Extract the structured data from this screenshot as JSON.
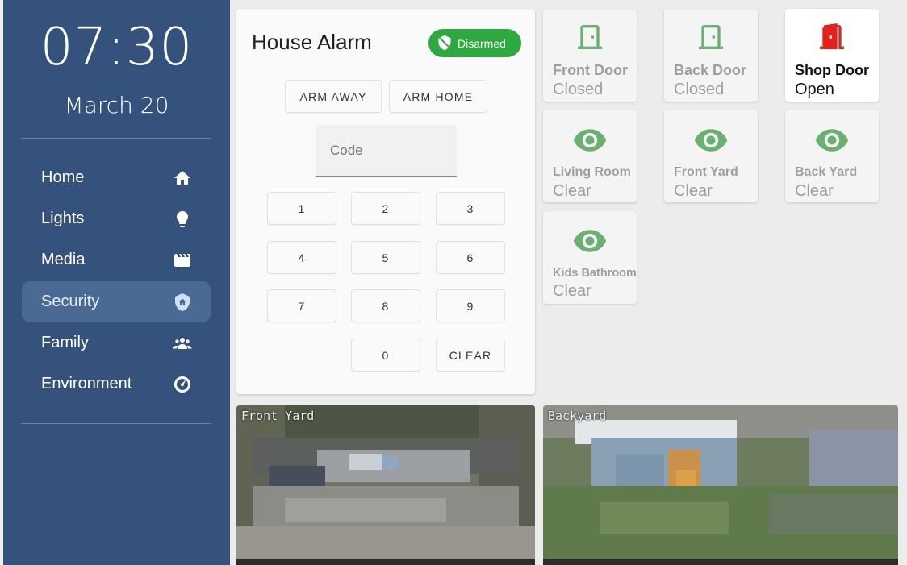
{
  "sidebar": {
    "time": "07:30",
    "date": "March 20",
    "items": [
      {
        "label": "Home",
        "icon": "home-icon"
      },
      {
        "label": "Lights",
        "icon": "lightbulb-icon"
      },
      {
        "label": "Media",
        "icon": "movie-clapper-icon"
      },
      {
        "label": "Security",
        "icon": "shield-home-icon",
        "active": true
      },
      {
        "label": "Family",
        "icon": "people-group-icon"
      },
      {
        "label": "Environment",
        "icon": "gauge-icon"
      }
    ],
    "background_color": "#34527b",
    "active_color": "#4a6a94"
  },
  "alarm": {
    "title": "House Alarm",
    "status": "Disarmed",
    "status_color": "#2ea840",
    "arm_away_label": "ARM AWAY",
    "arm_home_label": "ARM HOME",
    "code_placeholder": "Code",
    "keys": [
      "1",
      "2",
      "3",
      "4",
      "5",
      "6",
      "7",
      "8",
      "9",
      "0"
    ],
    "clear_label": "CLEAR"
  },
  "sensors": [
    {
      "name": "Front Door",
      "state": "Closed",
      "icon": "door-closed-icon"
    },
    {
      "name": "Back Door",
      "state": "Closed",
      "icon": "door-closed-icon"
    },
    {
      "name": "Shop Door",
      "state": "Open",
      "icon": "door-open-icon",
      "alert": true
    },
    {
      "name": "Living Room",
      "state": "Clear",
      "icon": "eye-icon"
    },
    {
      "name": "Front Yard",
      "state": "Clear",
      "icon": "eye-icon"
    },
    {
      "name": "Back Yard",
      "state": "Clear",
      "icon": "eye-icon"
    },
    {
      "name": "Kids Bathroom",
      "state": "Clear",
      "icon": "eye-icon"
    }
  ],
  "colors": {
    "ok_icon": "#6ab071",
    "alert_icon": "#e5211c"
  },
  "cameras": [
    {
      "label": "Front Yard"
    },
    {
      "label": "Backyard"
    }
  ]
}
